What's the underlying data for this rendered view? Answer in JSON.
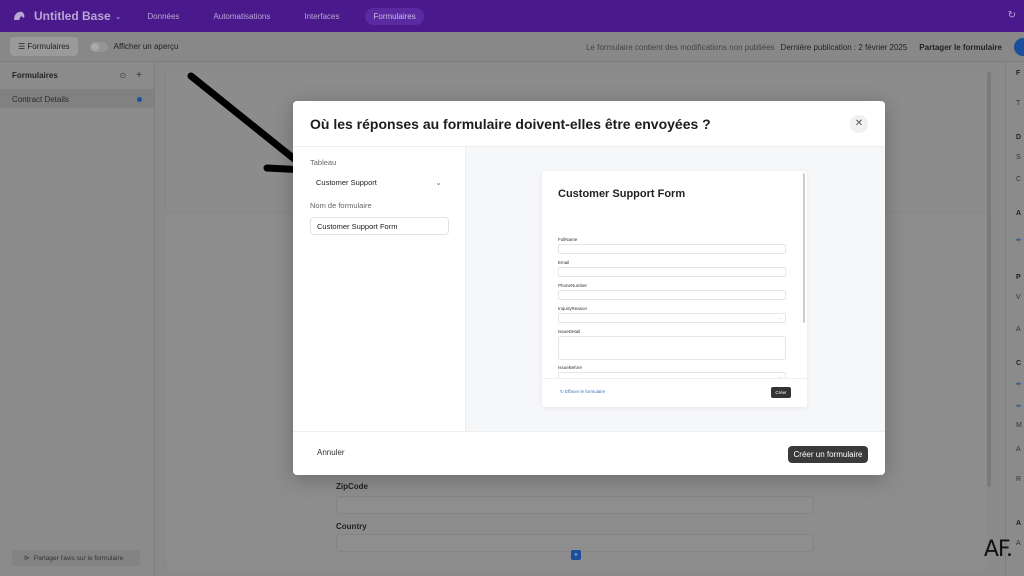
{
  "app": {
    "base_title": "Untitled Base",
    "nav": [
      "Données",
      "Automatisations",
      "Interfaces",
      "Formulaires"
    ],
    "active_nav": "Formulaires",
    "accent_color": "#4a1a8c"
  },
  "subbar": {
    "forms_button": "Formulaires",
    "preview_toggle_label": "Afficher un aperçu",
    "unpublished_notice": "Le formulaire contient des modifications non publiées",
    "last_published": "Dernière publication : 2 février 2025",
    "share_button": "Partager le formulaire"
  },
  "sidebar": {
    "heading": "Formulaires",
    "items": [
      {
        "label": "Contract Details",
        "active": true
      }
    ],
    "feedback_button": "Partager l'avis sur le formulaire"
  },
  "canvas": {
    "fields": [
      "ZipCode",
      "Country"
    ]
  },
  "right_panel": {
    "letters": [
      "F",
      "T",
      "D",
      "S",
      "C",
      "A",
      "P",
      "V",
      "A",
      "C",
      "M",
      "A",
      "R",
      "A",
      "A"
    ]
  },
  "modal": {
    "title": "Où les réponses au formulaire doivent-elles être envoyées ?",
    "table_label": "Tableau",
    "table_value": "Customer Support",
    "form_name_label": "Nom de formulaire",
    "form_name_value": "Customer Support Form",
    "cancel_button": "Annuler",
    "create_button": "Créer un formulaire",
    "preview": {
      "title": "Customer Support Form",
      "fields": [
        {
          "label": "FullName",
          "type": "text"
        },
        {
          "label": "Email",
          "type": "text"
        },
        {
          "label": "PhoneNumber",
          "type": "text"
        },
        {
          "label": "InquiryReason",
          "type": "select"
        },
        {
          "label": "IssueDetail",
          "type": "textarea"
        },
        {
          "label": "IssueBefore",
          "type": "select"
        }
      ],
      "clear_link": "Effacer le formulaire",
      "submit_button": "Créer"
    }
  },
  "watermark": "AF."
}
